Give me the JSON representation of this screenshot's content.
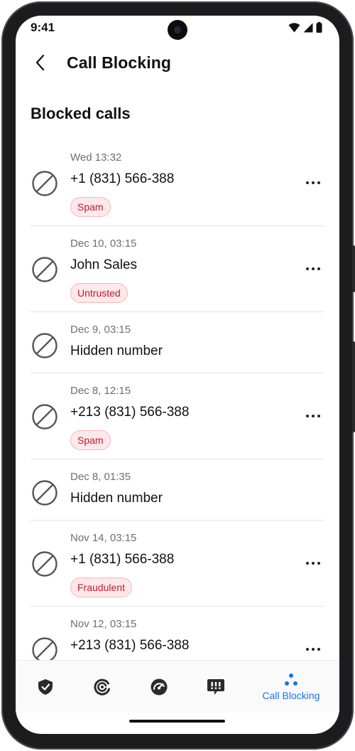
{
  "status_bar": {
    "time": "9:41"
  },
  "header": {
    "title": "Call Blocking"
  },
  "section": {
    "title": "Blocked calls"
  },
  "calls": [
    {
      "date": "Wed 13:32",
      "name": "+1 (831) 566-388",
      "tag": "Spam"
    },
    {
      "date": "Dec 10, 03:15",
      "name": "John Sales",
      "tag": "Untrusted"
    },
    {
      "date": "Dec 9, 03:15",
      "name": "Hidden number"
    },
    {
      "date": "Dec 8, 12:15",
      "name": "+213 (831) 566-388",
      "tag": "Spam"
    },
    {
      "date": "Dec 8, 01:35",
      "name": "Hidden number"
    },
    {
      "date": "Nov 14, 03:15",
      "name": "+1 (831) 566-388",
      "tag": "Fraudulent"
    },
    {
      "date": "Nov 12, 03:15",
      "name": "+213 (831) 566-388"
    }
  ],
  "bottom_nav": {
    "items": [
      {
        "icon": "shield-icon"
      },
      {
        "icon": "scan-icon"
      },
      {
        "icon": "speedometer-icon"
      },
      {
        "icon": "message-alert-icon"
      },
      {
        "icon": "call-blocking-icon",
        "label": "Call Blocking",
        "active": true
      }
    ]
  },
  "colors": {
    "accent": "#1a73e8",
    "tag_text": "#c5192d",
    "tag_bg": "#fde8ea"
  }
}
